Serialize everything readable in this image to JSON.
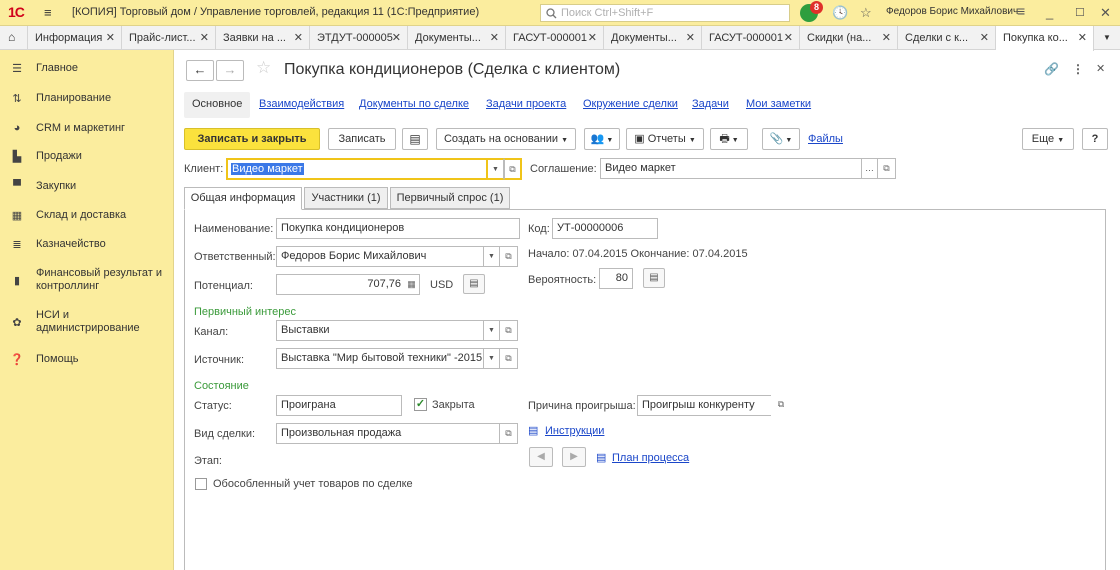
{
  "titlebar": {
    "logo": "1С",
    "title": "[КОПИЯ] Торговый дом / Управление торговлей, редакция 11  (1С:Предприятие)",
    "search_placeholder": "Поиск Ctrl+Shift+F",
    "notifications_count": "8",
    "user": "Федоров Борис Михайлович"
  },
  "tabs": [
    {
      "label": "Информация"
    },
    {
      "label": "Прайс-лист..."
    },
    {
      "label": "Заявки на ..."
    },
    {
      "label": "ЭТДУТ-000005"
    },
    {
      "label": "Документы..."
    },
    {
      "label": "ГАСУТ-000001"
    },
    {
      "label": "Документы..."
    },
    {
      "label": "ГАСУТ-000001"
    },
    {
      "label": "Скидки (на..."
    },
    {
      "label": "Сделки с к..."
    },
    {
      "label": "Покупка ко..."
    }
  ],
  "sidebar": {
    "items": [
      {
        "label": "Главное"
      },
      {
        "label": "Планирование"
      },
      {
        "label": "CRM и маркетинг"
      },
      {
        "label": "Продажи"
      },
      {
        "label": "Закупки"
      },
      {
        "label": "Склад и доставка"
      },
      {
        "label": "Казначейство"
      },
      {
        "label": "Финансовый результат и",
        "label2": "контроллинг"
      },
      {
        "label": "НСИ и",
        "label2": "администрирование"
      },
      {
        "label": "Помощь"
      }
    ]
  },
  "form": {
    "title": "Покупка кондиционеров (Сделка с клиентом)",
    "nav": {
      "main": "Основное",
      "links": [
        "Взаимодействия",
        "Документы по сделке",
        "Задачи проекта",
        "Окружение сделки",
        "Задачи",
        "Мои заметки"
      ]
    },
    "toolbar": {
      "save_close": "Записать и закрыть",
      "save": "Записать",
      "create_based": "Создать на основании",
      "reports": "Отчеты",
      "files": "Файлы",
      "more": "Еще",
      "help": "?"
    },
    "client_label": "Клиент:",
    "client_value": "Видео маркет",
    "agreement_label": "Соглашение:",
    "agreement_value": "Видео маркет",
    "inner_tabs": [
      "Общая информация",
      "Участники (1)",
      "Первичный спрос (1)"
    ],
    "name_label": "Наименование:",
    "name_value": "Покупка кондиционеров",
    "code_label": "Код:",
    "code_value": "УТ-00000006",
    "responsible_label": "Ответственный:",
    "responsible_value": "Федоров Борис Михайлович",
    "dates_text": "Начало: 07.04.2015 Окончание: 07.04.2015",
    "potential_label": "Потенциал:",
    "potential_value": "707,76",
    "currency": "USD",
    "probability_label": "Вероятность:",
    "probability_value": "80",
    "primary_interest": "Первичный интерес",
    "channel_label": "Канал:",
    "channel_value": "Выставки",
    "source_label": "Источник:",
    "source_value": "Выставка \"Мир бытовой техники\" -2015",
    "state_heading": "Состояние",
    "status_label": "Статус:",
    "status_value": "Проиграна",
    "closed_label": "Закрыта",
    "closed_checked": true,
    "loss_reason_label": "Причина проигрыша:",
    "loss_reason_value": "Проигрыш конкуренту",
    "deal_type_label": "Вид сделки:",
    "deal_type_value": "Произвольная продажа",
    "instructions_link": "Инструкции",
    "stage_label": "Этап:",
    "process_plan_link": "План процесса",
    "separate_accounting_label": "Обособленный учет товаров по сделке",
    "separate_accounting_checked": false
  },
  "colors": {
    "accent_yellow": "#fbed9e",
    "button_yellow": "#fbe23d",
    "link_blue": "#1a46c9",
    "group_green": "#3a9a3a",
    "logo_red": "#d0021b"
  }
}
